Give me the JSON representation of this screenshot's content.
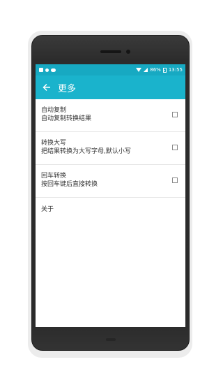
{
  "statusbar": {
    "battery": "86%",
    "time": "13:55"
  },
  "appbar": {
    "title": "更多"
  },
  "settings": [
    {
      "title": "自动复制",
      "subtitle": "自动复制转换结果",
      "checked": false
    },
    {
      "title": "转换大写",
      "subtitle": "把结果转换为大写字母,默认小写",
      "checked": false
    },
    {
      "title": "回车转换",
      "subtitle": "按回车键后直接转换",
      "checked": false
    }
  ],
  "about": {
    "label": "关于"
  },
  "colors": {
    "statusbar": "#17a9c2",
    "appbar": "#1ab3cc"
  }
}
